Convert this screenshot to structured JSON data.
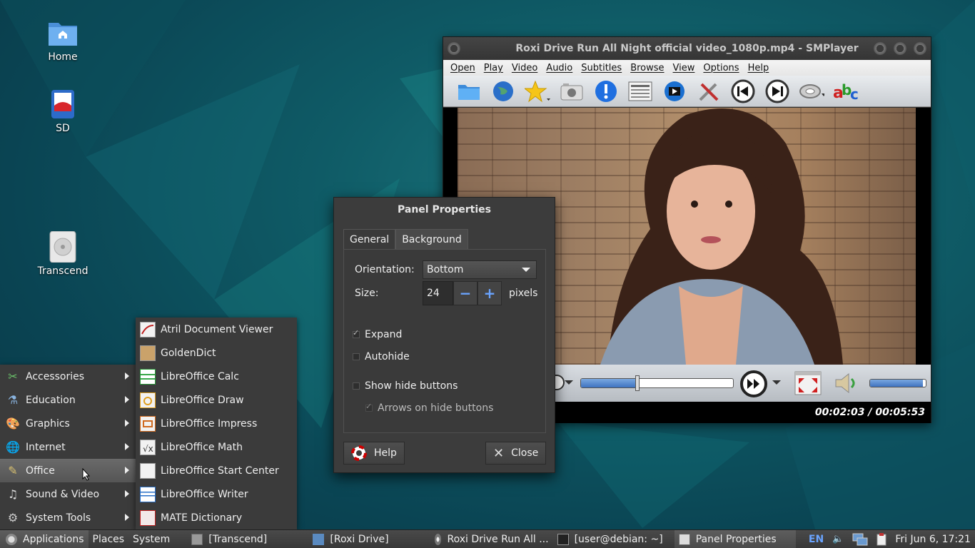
{
  "desktop": {
    "icons": [
      {
        "label": "Home",
        "icon": "folder-home-icon"
      },
      {
        "label": "SD",
        "icon": "sd-card-icon"
      },
      {
        "label": "Transcend",
        "icon": "drive-icon"
      }
    ]
  },
  "smplayer": {
    "title": "Roxi Drive Run All Night official video_1080p.mp4 - SMPlayer",
    "menu": [
      "Open",
      "Play",
      "Video",
      "Audio",
      "Subtitles",
      "Browse",
      "View",
      "Options",
      "Help"
    ],
    "toolbar": [
      "open-folder-icon",
      "globe-icon",
      "favorites-star-icon",
      "screenshot-camera-icon",
      "info-icon",
      "playlist-icon",
      "video-clip-icon",
      "tools-icon",
      "previous-icon",
      "next-icon",
      "audio-disc-icon",
      "subtitles-abc-icon"
    ],
    "seek_progress": 0.37,
    "volume_level": 0.95,
    "time": "00:02:03 / 00:05:53"
  },
  "dialog": {
    "title": "Panel Properties",
    "tabs": [
      "General",
      "Background"
    ],
    "orientation_label": "Orientation:",
    "orientation_value": "Bottom",
    "size_label": "Size:",
    "size_value": "24",
    "size_unit": "pixels",
    "expand_label": "Expand",
    "expand_checked": true,
    "autohide_label": "Autohide",
    "autohide_checked": false,
    "show_hide_label": "Show hide buttons",
    "show_hide_checked": false,
    "arrows_label": "Arrows on hide buttons",
    "arrows_checked": true,
    "help_label": "Help",
    "close_label": "Close"
  },
  "menu": {
    "categories": [
      {
        "label": "Accessories",
        "icon": "accessories-icon"
      },
      {
        "label": "Education",
        "icon": "education-icon"
      },
      {
        "label": "Graphics",
        "icon": "graphics-icon"
      },
      {
        "label": "Internet",
        "icon": "internet-icon"
      },
      {
        "label": "Office",
        "icon": "office-icon"
      },
      {
        "label": "Sound & Video",
        "icon": "sound-video-icon"
      },
      {
        "label": "System Tools",
        "icon": "system-tools-icon"
      }
    ],
    "office_items": [
      {
        "label": "Atril Document Viewer",
        "icon": "atril-icon"
      },
      {
        "label": "GoldenDict",
        "icon": "goldendict-icon"
      },
      {
        "label": "LibreOffice Calc",
        "icon": "calc-icon"
      },
      {
        "label": "LibreOffice Draw",
        "icon": "draw-icon"
      },
      {
        "label": "LibreOffice Impress",
        "icon": "impress-icon"
      },
      {
        "label": "LibreOffice Math",
        "icon": "math-icon"
      },
      {
        "label": "LibreOffice Start Center",
        "icon": "startcenter-icon"
      },
      {
        "label": "LibreOffice Writer",
        "icon": "writer-icon"
      },
      {
        "label": "MATE Dictionary",
        "icon": "dictionary-icon"
      }
    ]
  },
  "panel": {
    "applications": "Applications",
    "places": "Places",
    "system": "System",
    "tasks": [
      "[Transcend]",
      "[Roxi Drive]",
      "Roxi Drive Run All ...",
      "[user@debian: ~]",
      "Panel Properties"
    ],
    "keyboard": "EN",
    "clock": "Fri Jun  6, 17:21"
  }
}
